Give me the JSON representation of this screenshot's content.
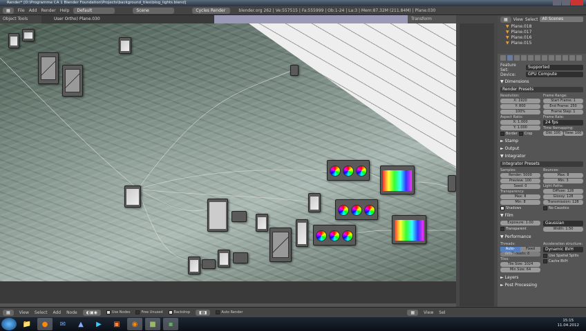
{
  "window": {
    "title": "Render* [D:\\Programme CA 1 Blender Foundation\\Projects\\background_tiles\\blog_lights.blend]"
  },
  "menubar": {
    "menus": [
      "File",
      "Add",
      "Render",
      "Help"
    ],
    "layout": "Default",
    "scene": "Scene",
    "engine": "Cycles Render",
    "info": "blender.org 262 | Ve:557515 | Fa:555999 | Ob:1-24 | La:3 | Mem:87.32M (211.84M) | Plane.030"
  },
  "node_editor": {
    "tools_label": "Object Tools",
    "view_label": "User Ortho) Plane.030",
    "transform_label": "Transform"
  },
  "outliner": {
    "view": "View",
    "select": "Select",
    "filter": "All Scenes",
    "items": [
      "Plane.018",
      "Plane.017",
      "Plane.016",
      "Plane.015"
    ]
  },
  "properties": {
    "feature_set_label": "Feature Set:",
    "feature_set": "Supported",
    "device_label": "Device:",
    "device": "GPU Compute",
    "dimensions": "Dimensions",
    "render_presets": "Render Presets",
    "resolution": "Resolution:",
    "res_x": "X: 1920",
    "res_y": "Y: 800",
    "res_pct": "100%",
    "frame_range": "Frame Range:",
    "start": "Start Frame: 1",
    "end": "End Frame: 250",
    "step": "Frame Step: 1",
    "aspect": "Aspect Ratio:",
    "asp_x": "X: 1.000",
    "asp_y": "Y: 1.000",
    "border": "Border",
    "crop": "Crop",
    "frame_rate": "Frame Rate:",
    "fps": "24 fps",
    "time_remap": "Time Remapping:",
    "old": "Old: 100",
    "new": "New: 100",
    "stamp": "Stamp",
    "output": "Output",
    "integrator": "Integrator",
    "integrator_presets": "Integrator Presets",
    "samples": "Samples:",
    "render": "Render: 5000",
    "preview": "Preview: 100",
    "seed": "Seed: 0",
    "bounces": "Bounces:",
    "b_max": "Max: 8",
    "b_min": "Min: 3",
    "transparency": "Transparency:",
    "t_max": "Max: 8",
    "t_min": "Min: 8",
    "light_paths": "Light Paths:",
    "diffuse": "Diffuse: 128",
    "glossy": "Glossy: 128",
    "transmission": "Transmission: 128",
    "shadows": "Shadows",
    "no_caustics": "No Caustics",
    "film": "Film",
    "exposure": "Exposure: 1.00",
    "filter": "Gaussian",
    "width": "Width: 1.50",
    "transparent": "Transparent",
    "performance": "Performance",
    "threads": "Threads:",
    "auto_detect": "Auto-detect",
    "fixed": "Fixed",
    "threads_n": "Threads: 8",
    "accel": "Acceleration structure:",
    "bvh": "Dynamic BVH",
    "spatial": "Use Spatial Splits",
    "cache_bvh": "Cache BVH",
    "tiles": "Tiles:",
    "tile_size": "Tile Size: 1024",
    "min_size": "Min Size: 64",
    "layers": "Layers",
    "post": "Post Processing"
  },
  "footer": {
    "menus": [
      "View",
      "Select",
      "Add",
      "Node"
    ],
    "use_nodes": "Use Nodes",
    "free_unused": "Free Unused",
    "backdrop": "Backdrop",
    "auto_render": "Auto Render",
    "right_view": "View",
    "right_select": "Sel"
  },
  "taskbar": {
    "time": "15:15",
    "date": "11.04.2012"
  }
}
